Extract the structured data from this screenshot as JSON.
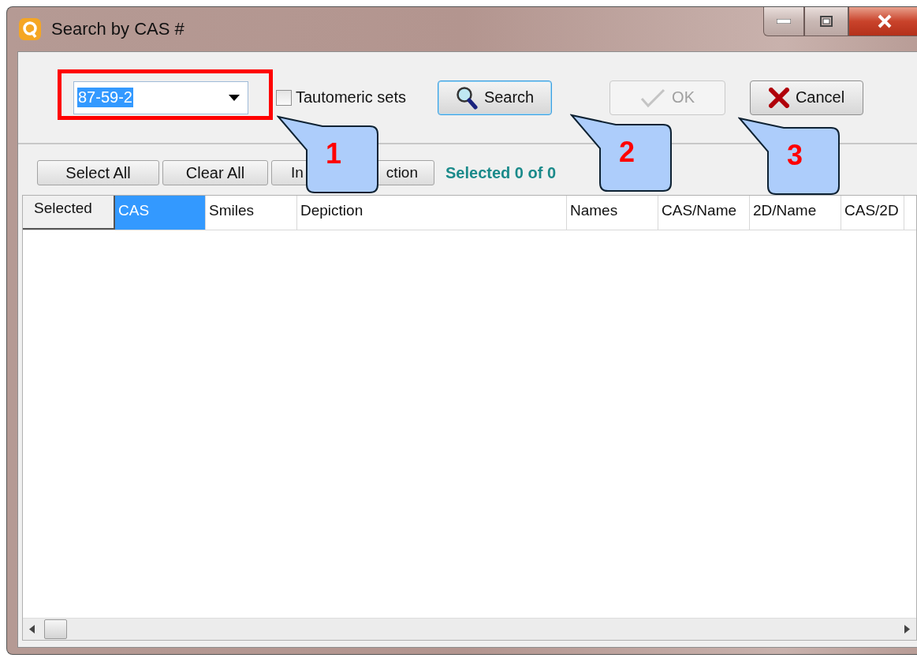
{
  "window": {
    "title": "Search by CAS #"
  },
  "search_bar": {
    "cas_field": {
      "value": "87-59-2",
      "highlighted": true
    },
    "tautomeric_sets": {
      "label": "Tautomeric sets",
      "checked": false
    },
    "buttons": [
      {
        "label": "Search",
        "kind": "search",
        "disabled": false
      },
      {
        "label": "OK",
        "kind": "ok",
        "disabled": true
      },
      {
        "label": "Cancel",
        "kind": "cancel",
        "disabled": false
      }
    ]
  },
  "selection_bar": {
    "buttons": [
      {
        "label_parts": [
          "Select All"
        ]
      },
      {
        "label_parts": [
          "Clear All"
        ]
      },
      {
        "label_parts": [
          "In",
          "ction"
        ]
      }
    ],
    "status": "Selected 0 of 0"
  },
  "table": {
    "columns": [
      {
        "label": "Selected",
        "kind": "corner",
        "selected": false
      },
      {
        "label": "CAS",
        "kind": "column",
        "selected": true
      },
      {
        "label": "Smiles",
        "kind": "column",
        "selected": false
      },
      {
        "label": "Depiction",
        "kind": "column",
        "selected": false
      },
      {
        "label": "Names",
        "kind": "column",
        "selected": false
      },
      {
        "label": "CAS/Name",
        "kind": "column",
        "selected": false
      },
      {
        "label": "2D/Name",
        "kind": "column",
        "selected": false
      },
      {
        "label": "CAS/2D",
        "kind": "column",
        "selected": false
      }
    ]
  },
  "callouts": [
    {
      "number": "1"
    },
    {
      "number": "2"
    },
    {
      "number": "3"
    }
  ]
}
